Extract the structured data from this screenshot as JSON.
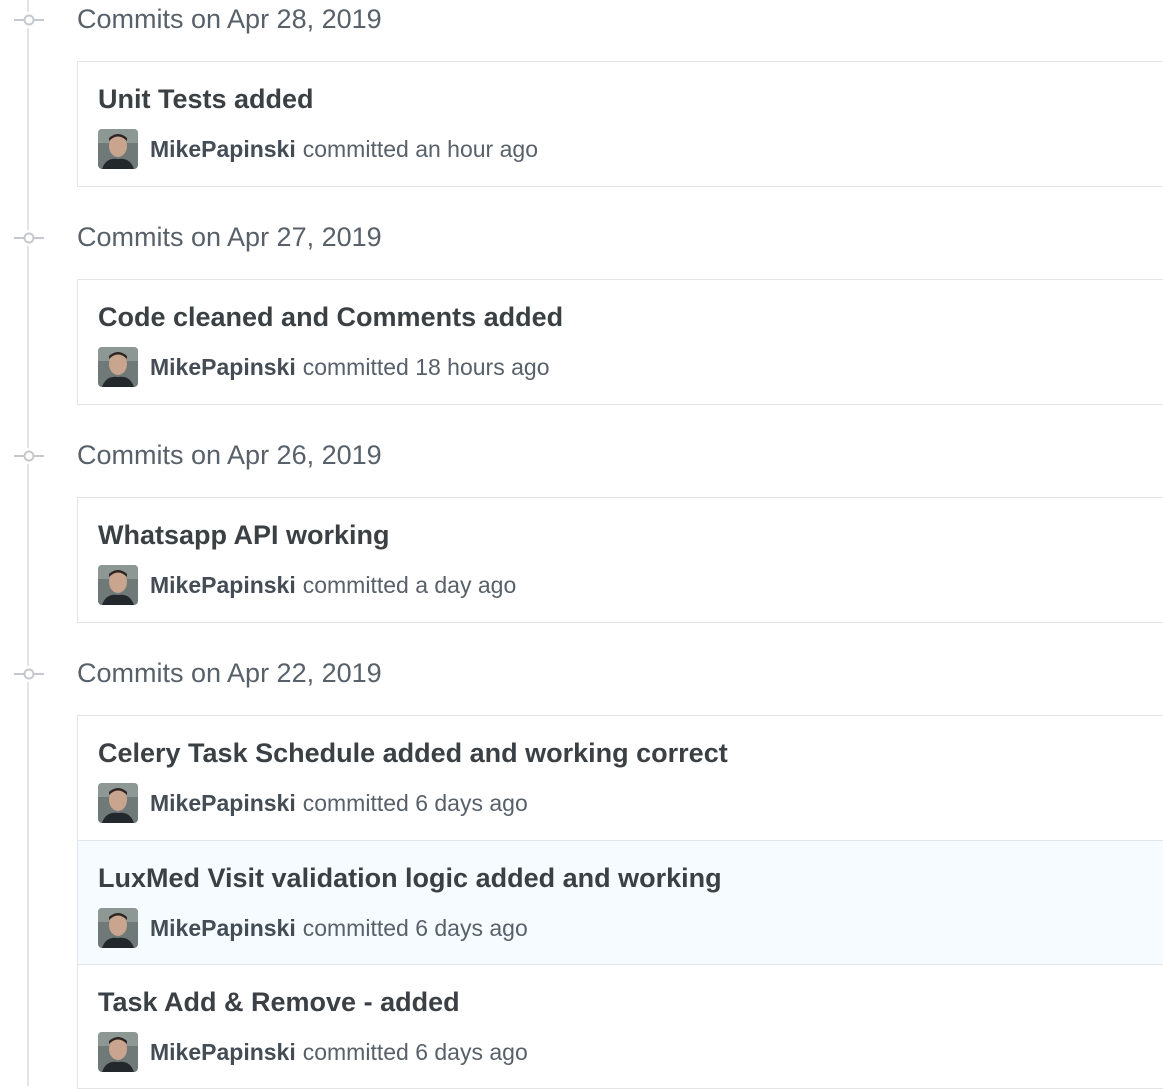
{
  "groups": [
    {
      "date_label": "Commits on Apr 28, 2019",
      "commits": [
        {
          "title": "Unit Tests added",
          "author": "MikePapinski",
          "committed_text": "committed an hour ago"
        }
      ]
    },
    {
      "date_label": "Commits on Apr 27, 2019",
      "commits": [
        {
          "title": "Code cleaned and Comments added",
          "author": "MikePapinski",
          "committed_text": "committed 18 hours ago"
        }
      ]
    },
    {
      "date_label": "Commits on Apr 26, 2019",
      "commits": [
        {
          "title": "Whatsapp API working",
          "author": "MikePapinski",
          "committed_text": "committed a day ago"
        }
      ]
    },
    {
      "date_label": "Commits on Apr 22, 2019",
      "commits": [
        {
          "title": "Celery Task Schedule added and working correct",
          "author": "MikePapinski",
          "committed_text": "committed 6 days ago"
        },
        {
          "title": "LuxMed Visit validation logic added and working",
          "author": "MikePapinski",
          "committed_text": "committed 6 days ago"
        },
        {
          "title": "Task Add & Remove - added",
          "author": "MikePapinski",
          "committed_text": "committed 6 days ago"
        }
      ]
    }
  ],
  "icons": {
    "group_marker": "git-commit-icon",
    "avatar": "user-avatar"
  },
  "colors": {
    "timeline": "#e1e4e8",
    "highlight_row": "#f6fbff",
    "title_text": "#3b4045",
    "muted_text": "#586069"
  }
}
